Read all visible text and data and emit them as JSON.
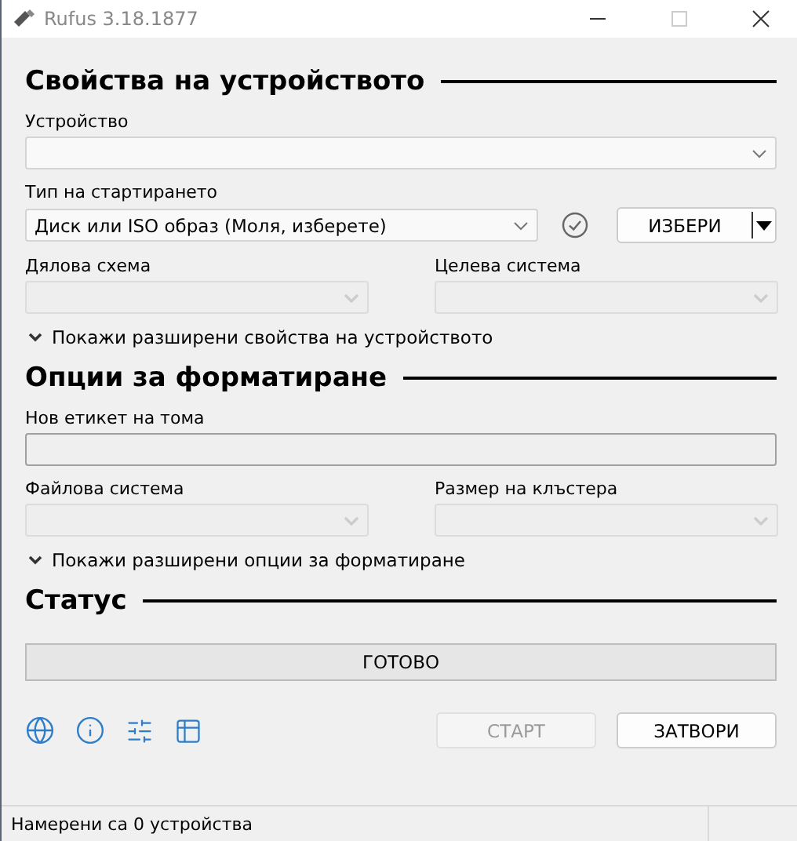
{
  "window": {
    "title": "Rufus 3.18.1877"
  },
  "sections": [
    {
      "heading": "Свойства на устройството",
      "items": [
        {
          "kind": "select",
          "label": "Устройство",
          "disabled": false
        },
        {
          "kind": "boot",
          "label": "Тип на стартирането",
          "value": "Диск или ISO образ (Моля, изберете)",
          "button": "ИЗБЕРИ"
        },
        {
          "kind": "pair",
          "fields": [
            {
              "label": "Дялова схема",
              "disabled": true
            },
            {
              "label": "Целева система",
              "disabled": true
            }
          ]
        },
        {
          "kind": "expander",
          "label": "Покажи разширени свойства на устройството",
          "expanded": false
        }
      ]
    },
    {
      "heading": "Опции за форматиране",
      "items": [
        {
          "kind": "input",
          "label": "Нов етикет на тома"
        },
        {
          "kind": "pair",
          "fields": [
            {
              "label": "Файлова система",
              "disabled": true
            },
            {
              "label": "Размер на клъстера",
              "disabled": true
            }
          ]
        },
        {
          "kind": "expander",
          "label": "Покажи разширени опции за форматиране",
          "expanded": false
        }
      ]
    },
    {
      "heading": "Статус",
      "items": [
        {
          "kind": "progress",
          "text": "ГОТОВО"
        }
      ]
    }
  ],
  "buttons": [
    {
      "label": "СТАРТ",
      "disabled": true
    },
    {
      "label": "ЗАТВОРИ",
      "disabled": false
    }
  ],
  "status_bar": {
    "text": "Намерени са 0 устройства"
  }
}
